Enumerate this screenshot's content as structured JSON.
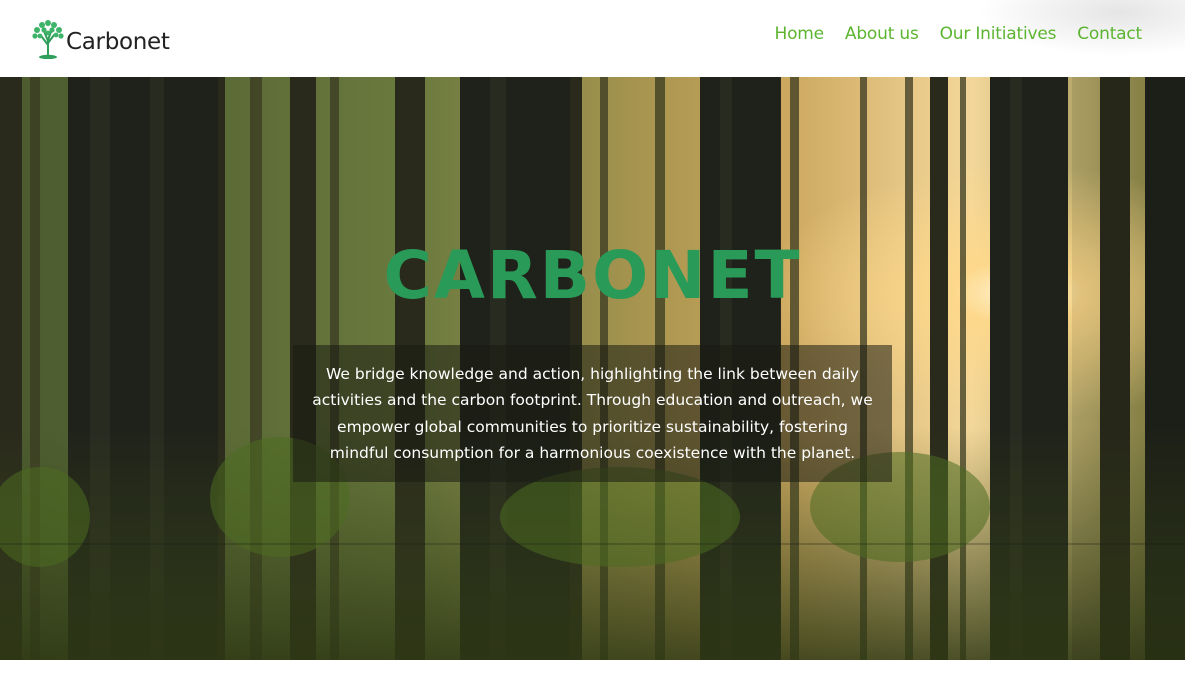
{
  "brand": {
    "name": "Carbonet",
    "logo_icon": "tree-icon",
    "color": "#5cb531"
  },
  "nav": {
    "items": [
      {
        "label": "Home"
      },
      {
        "label": "About us"
      },
      {
        "label": "Our Initiatives"
      },
      {
        "label": "Contact"
      }
    ]
  },
  "hero": {
    "title": "CARBONET",
    "title_color": "#2a9a58",
    "description": "We bridge knowledge and action, highlighting the link between daily activities and the carbon footprint. Through education and outreach, we empower global communities to prioritize sustainability, fostering mindful consumption for a harmonious coexistence with the planet.",
    "background": "forest-image"
  }
}
